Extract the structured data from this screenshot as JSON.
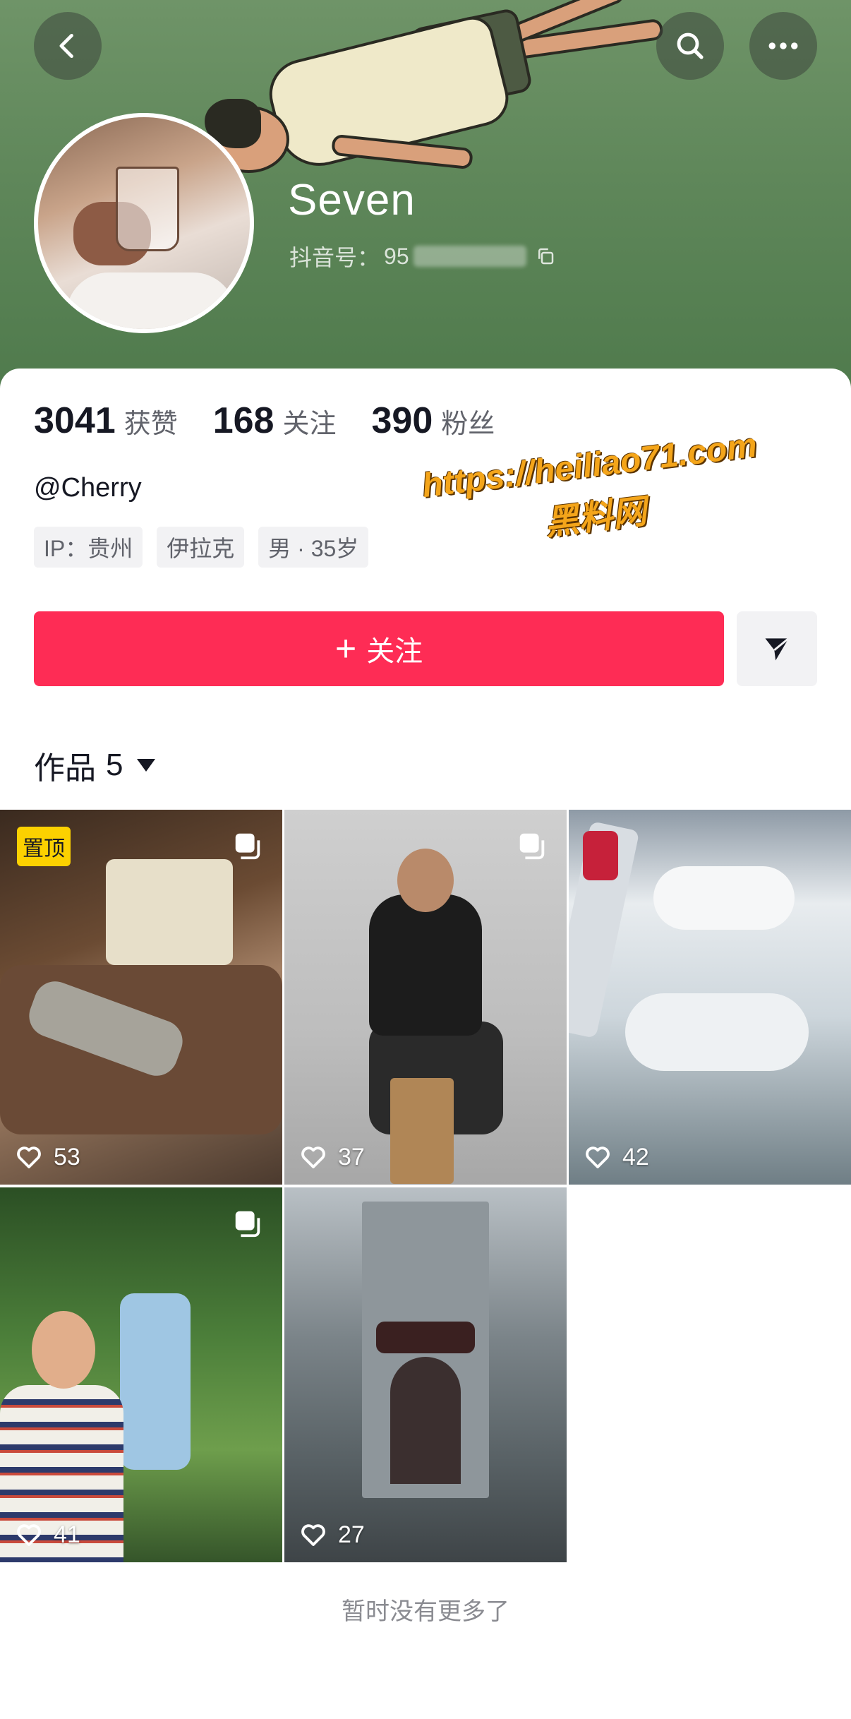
{
  "header": {
    "username": "Seven",
    "douyin_id_label": "抖音号：",
    "douyin_id_prefix": "95"
  },
  "stats": [
    {
      "num": "3041",
      "label": "获赞"
    },
    {
      "num": "168",
      "label": "关注"
    },
    {
      "num": "390",
      "label": "粉丝"
    }
  ],
  "profile": {
    "handle": "@Cherry",
    "tags": [
      "IP：贵州",
      "伊拉克",
      "男 · 35岁"
    ]
  },
  "watermark": {
    "url": "https://heiliao71.com",
    "name": "黑料网"
  },
  "actions": {
    "follow_plus": "+",
    "follow_label": "关注"
  },
  "works": {
    "title": "作品",
    "count": "5",
    "items": [
      {
        "likes": "53",
        "pinned_label": "置顶"
      },
      {
        "likes": "37"
      },
      {
        "likes": "42"
      },
      {
        "likes": "41"
      },
      {
        "likes": "27"
      }
    ],
    "end_text": "暂时没有更多了"
  },
  "colors": {
    "accent": "#fe2c55",
    "pin_badge": "#fcd100"
  },
  "icons": [
    "back-icon",
    "search-icon",
    "more-icon",
    "copy-icon",
    "send-icon",
    "heart-icon",
    "multi-photo-icon"
  ]
}
